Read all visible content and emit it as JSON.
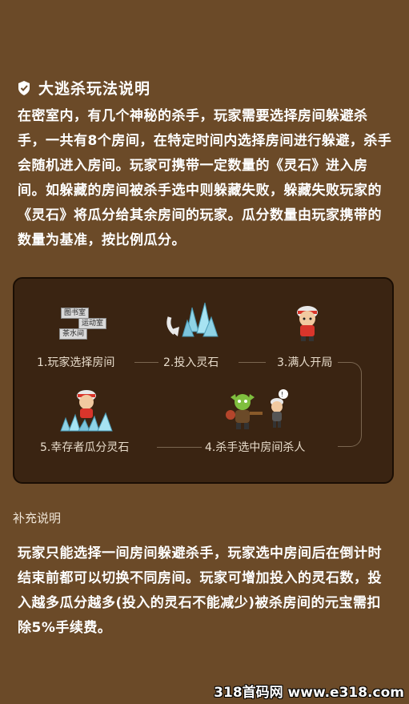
{
  "header": {
    "title": "大逃杀玩法说明",
    "icon": "check-badge-icon"
  },
  "description": "在密室内，有几个神秘的杀手，玩家需要选择房间躲避杀手，一共有8个房间，在特定时间内选择房间进行躲避，杀手会随机进入房间。玩家可携带一定数量的《灵石》进入房间。如躲藏的房间被杀手选中则躲藏失败，躲藏失败玩家的《灵石》将瓜分给其余房间的玩家。瓜分数量由玩家携带的数量为基准，按比例瓜分。",
  "flow": {
    "rooms": [
      "图书室",
      "运动室",
      "茶水间"
    ],
    "steps": [
      {
        "label": "1.玩家选择房间",
        "icon": "room-tags-icon"
      },
      {
        "label": "2.投入灵石",
        "icon": "crystal-icon"
      },
      {
        "label": "3.满人开局",
        "icon": "player-icon"
      },
      {
        "label": "4.杀手选中房间杀人",
        "icon": "killer-icon"
      },
      {
        "label": "5.幸存者瓜分灵石",
        "icon": "survivor-icon"
      }
    ]
  },
  "supplement": {
    "title": "补充说明",
    "text": "玩家只能选择一间房间躲避杀手，玩家选中房间后在倒计时结束前都可以切换不同房间。玩家可增加投入的灵石数，投入越多瓜分越多(投入的灵石不能减少)被杀房间的元宝需扣除5%手续费。"
  },
  "watermark": "318首码网 www.e318.com",
  "colors": {
    "background": "#6b4a28",
    "panel": "#3a2412",
    "text": "#ffffff"
  }
}
